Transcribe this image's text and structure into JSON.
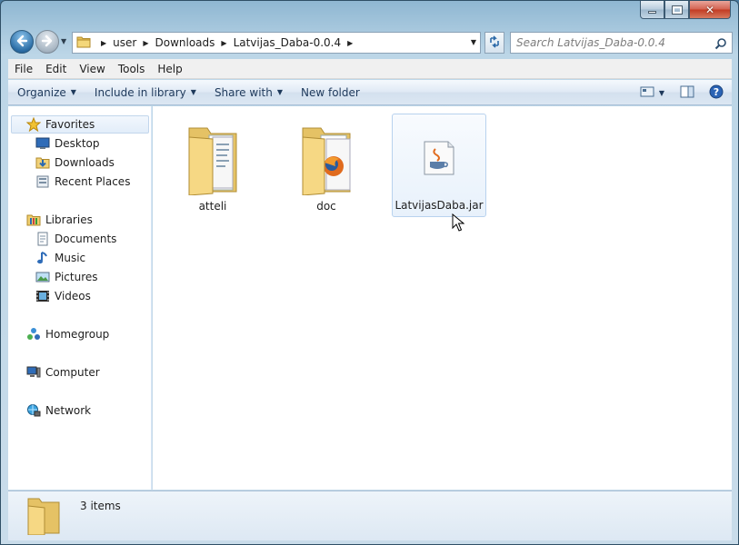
{
  "window": {
    "caption_buttons": {
      "minimize": "minimize",
      "maximize": "maximize",
      "close": "✕"
    }
  },
  "nav": {
    "breadcrumbs": [
      "user",
      "Downloads",
      "Latvijas_Daba-0.0.4"
    ],
    "search_placeholder": "Search Latvijas_Daba-0.0.4"
  },
  "menubar": {
    "items": [
      "File",
      "Edit",
      "View",
      "Tools",
      "Help"
    ]
  },
  "toolbar": {
    "organize": "Organize",
    "include_in_library": "Include in library",
    "share_with": "Share with",
    "new_folder": "New folder"
  },
  "sidebar": {
    "favorites": "Favorites",
    "favorites_items": [
      "Desktop",
      "Downloads",
      "Recent Places"
    ],
    "libraries": "Libraries",
    "libraries_items": [
      "Documents",
      "Music",
      "Pictures",
      "Videos"
    ],
    "homegroup": "Homegroup",
    "computer": "Computer",
    "network": "Network"
  },
  "files": [
    {
      "name": "atteli",
      "type": "folder"
    },
    {
      "name": "doc",
      "type": "folder"
    },
    {
      "name": "LatvijasDaba.jar",
      "type": "jar",
      "selected": true
    }
  ],
  "status": {
    "item_count": "3 items"
  },
  "colors": {
    "window_frame": "#8fb7d2",
    "selection_border": "#b8d2ee",
    "close_button": "#c23b22",
    "toolbar_text": "#1e395b"
  }
}
